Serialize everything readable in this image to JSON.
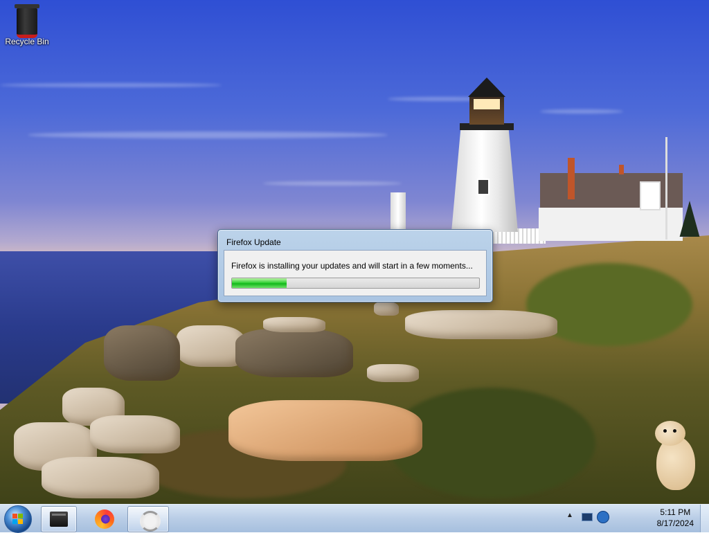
{
  "desktop": {
    "icons": [
      {
        "label": "Recycle Bin",
        "icon": "recycle-bin-icon"
      }
    ]
  },
  "dialog": {
    "title": "Firefox Update",
    "message": "Firefox is installing your updates and will start in a few moments...",
    "progress": 0.22,
    "progress_color": "#1fbf28"
  },
  "taskbar": {
    "start_icon": "windows-start-orb-icon",
    "pinned": [
      {
        "name": "terminal",
        "icon": "terminal-icon"
      },
      {
        "name": "firefox",
        "icon": "firefox-icon"
      },
      {
        "name": "updater",
        "icon": "sync-icon"
      }
    ],
    "tray": {
      "icons": [
        "show-hidden-icons-arrow",
        "network-icon",
        "volume-icon"
      ],
      "time": "5:11 PM",
      "date": "8/17/2024"
    }
  },
  "colors": {
    "taskbar": "#b9cde6",
    "dialog_frame": "#a9c4e2",
    "sky": "#4d6ad8"
  }
}
